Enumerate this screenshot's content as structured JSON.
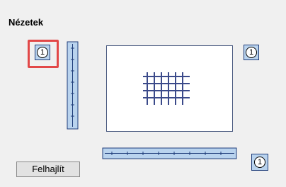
{
  "panel": {
    "title": "Nézetek",
    "felhajlit_label": "Felhajlít"
  },
  "views": {
    "top_left_number": "1",
    "right_top_number": "1",
    "bottom_right_number": "1"
  },
  "colors": {
    "accent_fill": "#b9d3ee",
    "accent_border": "#1f3d7a",
    "selection": "#e24848",
    "mesh": "#3b4a8a"
  }
}
